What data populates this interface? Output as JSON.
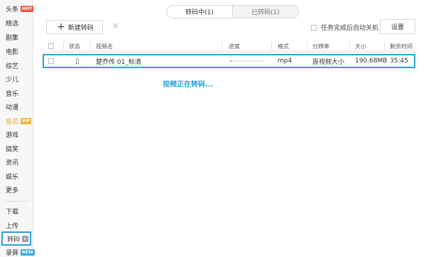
{
  "sidebar": {
    "items": [
      {
        "label": "头条",
        "badge": "HOT"
      },
      {
        "label": "精选"
      },
      {
        "label": "剧集"
      },
      {
        "label": "电影"
      },
      {
        "label": "综艺"
      },
      {
        "label": "少儿"
      },
      {
        "label": "音乐"
      },
      {
        "label": "动漫"
      },
      {
        "label": "会员",
        "badge": "VIP"
      },
      {
        "label": "游戏"
      },
      {
        "label": "搞笑"
      },
      {
        "label": "资讯"
      },
      {
        "label": "娱乐"
      },
      {
        "label": "更多"
      },
      {
        "label": "下载"
      },
      {
        "label": "上传"
      },
      {
        "label": "转码"
      },
      {
        "label": "录屏",
        "badge": "NEW"
      }
    ]
  },
  "tabs": [
    {
      "label": "转码中(1)"
    },
    {
      "label": "已转码(1)"
    }
  ],
  "toolbar": {
    "new_label": "新建转码",
    "auto_shutdown_label": "任务完成后自动关机",
    "settings_label": "设置"
  },
  "table": {
    "columns": [
      "状态",
      "视频名",
      "进度",
      "格式",
      "分辨率",
      "大小",
      "剩余时间"
    ],
    "rows": [
      {
        "name": "楚乔传 01_标清",
        "progress": 0.05,
        "format": "mp4",
        "resolution": "原视频大小",
        "size": "190.68MB",
        "remaining": "35:45"
      }
    ]
  },
  "status_message": "视频正在转码...",
  "colors": {
    "accent": "#2aa1d8",
    "vip": "#e8a62a",
    "hot": "#f5533d",
    "new": "#3ba7e6"
  }
}
